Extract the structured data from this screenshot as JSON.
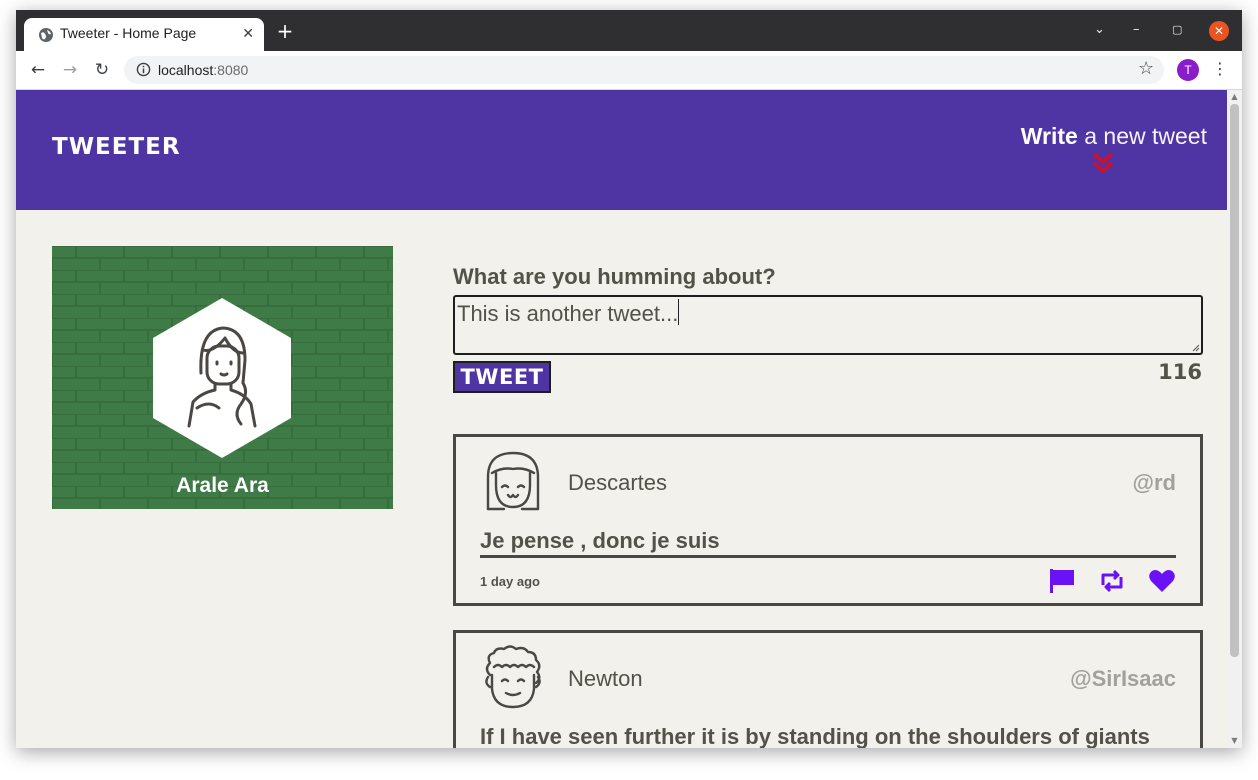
{
  "browser": {
    "tab_title": "Tweeter - Home Page",
    "tab_close": "✕",
    "new_tab": "+",
    "url_host": "localhost",
    "url_port": ":8080",
    "profile_initial": "T",
    "controls": {
      "tab_search": "⌄",
      "minimize": "–",
      "maximize": "▢",
      "close": "✕"
    },
    "nav": {
      "back": "←",
      "forward": "→",
      "reload": "↻"
    }
  },
  "site": {
    "brand": "TWEETER",
    "write_bold": "Write",
    "write_rest": " a new tweet",
    "accent": "#4f35a4",
    "chevron_color": "#e0081c"
  },
  "profile_card": {
    "name": "Arale Ara",
    "background": "#3e7a46"
  },
  "compose": {
    "label": "What are you humming about?",
    "value": "This is another tweet...",
    "button_label": "TWEET",
    "counter": "116"
  },
  "tweets": [
    {
      "author": "Descartes",
      "handle": "@rd",
      "content": "Je pense , donc je suis",
      "time": "1 day ago",
      "actions": [
        "flag-icon",
        "retweet-icon",
        "heart-icon"
      ]
    },
    {
      "author": "Newton",
      "handle": "@SirIsaac",
      "content": "If I have seen further it is by standing on the shoulders of giants",
      "time": "",
      "actions": [
        "flag-icon",
        "retweet-icon",
        "heart-icon"
      ]
    }
  ],
  "action_color": "#6a12f5"
}
